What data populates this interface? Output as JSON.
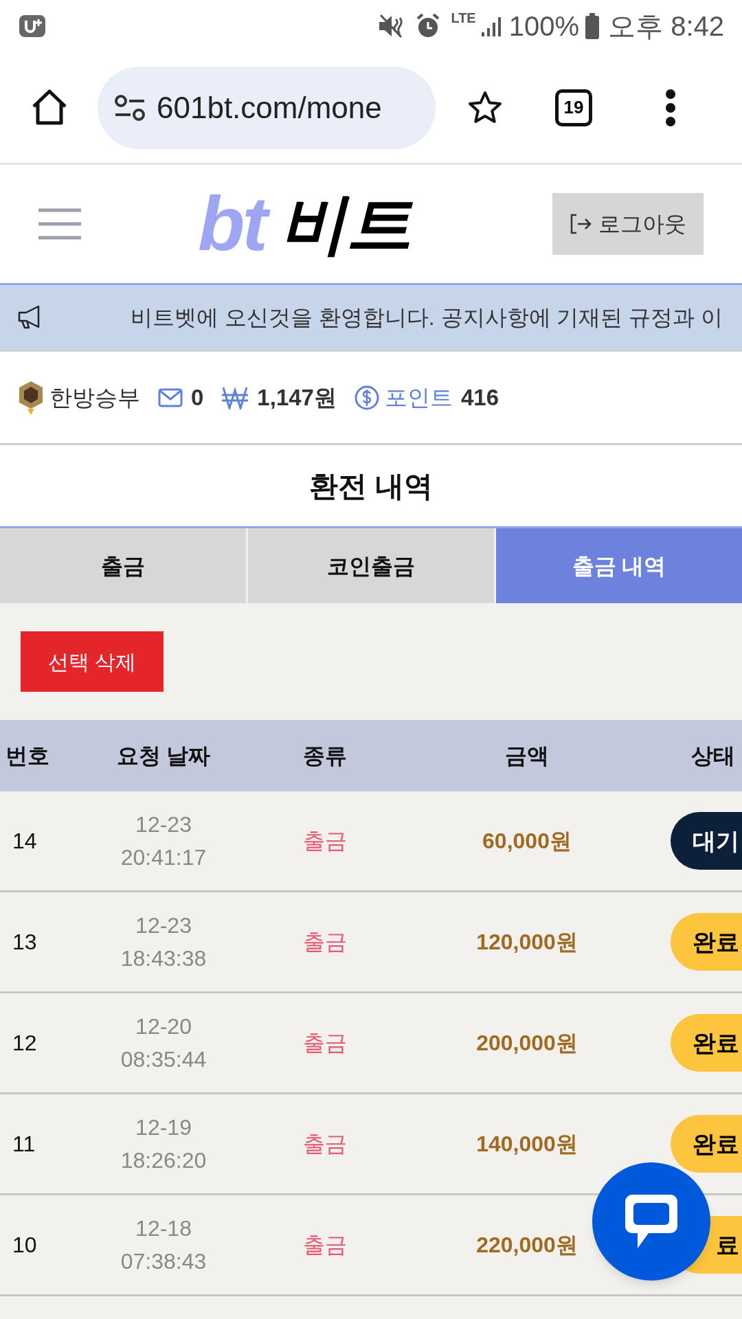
{
  "status_bar": {
    "battery": "100%",
    "time": "오후 8:42",
    "network": "LTE"
  },
  "browser": {
    "url": "601bt.com/mone",
    "tab_count": "19"
  },
  "header": {
    "logo_latin": "bt",
    "logo_korean": "비트",
    "logout": "로그아웃"
  },
  "notice": "비트벳에 오신것을 환영합니다. 공지사항에 기재된 규정과 이",
  "user": {
    "name": "한방승부",
    "messages": "0",
    "balance": "1,147원",
    "points_label": "포인트",
    "points": "416"
  },
  "title": "환전 내역",
  "tabs": [
    {
      "label": "출금",
      "selected": false
    },
    {
      "label": "코인출금",
      "selected": false
    },
    {
      "label": "출금 내역",
      "selected": true
    }
  ],
  "delete_button": "선택 삭제",
  "table": {
    "columns": [
      "번호",
      "요청 날짜",
      "종류",
      "금액",
      "상태"
    ],
    "rows": [
      {
        "number": "14",
        "date": "12-23",
        "time": "20:41:17",
        "type": "출금",
        "amount": "60,000원",
        "status": "대기",
        "kind": "pending"
      },
      {
        "number": "13",
        "date": "12-23",
        "time": "18:43:38",
        "type": "출금",
        "amount": "120,000원",
        "status": "완료",
        "kind": "done"
      },
      {
        "number": "12",
        "date": "12-20",
        "time": "08:35:44",
        "type": "출금",
        "amount": "200,000원",
        "status": "완료",
        "kind": "done"
      },
      {
        "number": "11",
        "date": "12-19",
        "time": "18:26:20",
        "type": "출금",
        "amount": "140,000원",
        "status": "완료",
        "kind": "done"
      },
      {
        "number": "10",
        "date": "12-18",
        "time": "07:38:43",
        "type": "출금",
        "amount": "220,000원",
        "status": "료",
        "kind": "done"
      }
    ]
  }
}
